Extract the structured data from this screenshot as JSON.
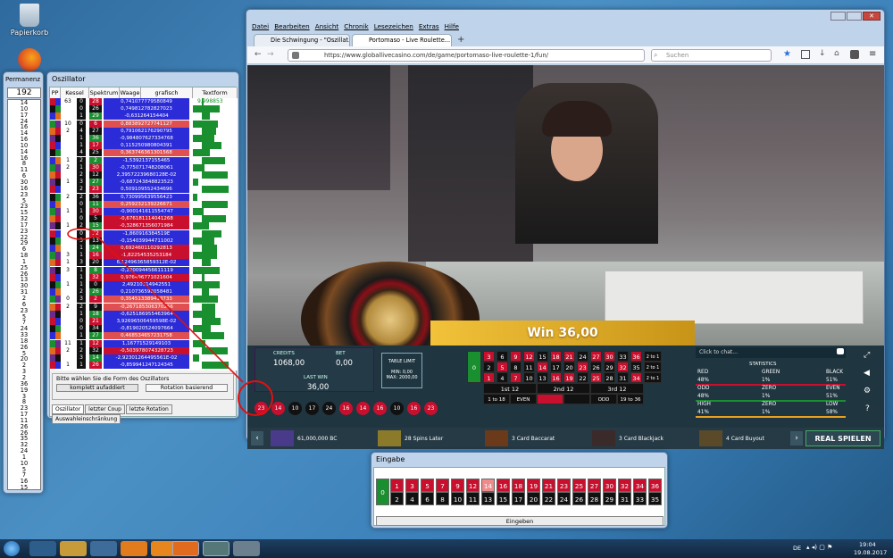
{
  "desktop": {
    "recycle_label": "Papierkorb"
  },
  "permanenz": {
    "title": "Permanenz",
    "current": "192",
    "numbers": [
      "14",
      "10",
      "17",
      "24",
      "16",
      "14",
      "16",
      "10",
      "14",
      "16",
      "8",
      "11",
      "6",
      "30",
      "16",
      "23",
      "5",
      "23",
      "15",
      "32",
      "17",
      "23",
      "22",
      "29",
      "6",
      "18",
      "1",
      "25",
      "26",
      "13",
      "30",
      "31",
      "2",
      "6",
      "23",
      "5",
      "7",
      "24",
      "33",
      "18",
      "26",
      "5",
      "20",
      "2",
      "3",
      "2",
      "36",
      "19",
      "3",
      "8",
      "23",
      "17",
      "11",
      "26",
      "26",
      "35",
      "32",
      "24",
      "1",
      "10",
      "5",
      "7",
      "16",
      "15",
      "13",
      "25",
      "26",
      "33",
      "17",
      "1",
      "28",
      "13",
      "33",
      "19",
      "35",
      "2",
      "7",
      "16",
      "14",
      "36",
      "2",
      "31",
      "18",
      "9",
      "15",
      "36",
      "36",
      "35",
      "19",
      "10",
      "23",
      "34",
      "29",
      "16",
      "2",
      "10",
      "35",
      "25",
      "15",
      "15",
      "14",
      "28",
      "35",
      "2",
      "9",
      "25",
      "15",
      "26",
      "22",
      "21",
      "27",
      "29",
      "20",
      "10",
      "17",
      "24",
      "35",
      "16",
      "25",
      "34",
      "14",
      "32",
      "28",
      "27",
      "26",
      "14",
      "21",
      "25",
      "3",
      "27",
      "14",
      "10"
    ]
  },
  "oszillator": {
    "title": "Oszillator",
    "headers": [
      "PP",
      "Kessel",
      "Spektrum",
      "Waage",
      "grafisch",
      "Textform"
    ],
    "top_text_value": "9,998853",
    "rows": [
      {
        "n": "63",
        "a": "0",
        "b": "28",
        "w": "0,741077779580849",
        "c": "#2b2bd8"
      },
      {
        "n": "",
        "a": "0",
        "b": "26",
        "w": "0,749812782827023",
        "c": "#2b2bd8"
      },
      {
        "n": "",
        "a": "1",
        "b": "29",
        "w": "-0,631264154404",
        "c": "#2b2bd8"
      },
      {
        "n": "10",
        "a": "0",
        "b": "6",
        "w": "0,883892727741127",
        "c": "#e05050"
      },
      {
        "n": "2",
        "a": "4",
        "b": "27",
        "w": "0,791062176290795",
        "c": "#2b2bd8"
      },
      {
        "n": "",
        "a": "1",
        "b": "36",
        "w": "-0,984807627334768",
        "c": "#2b2bd8"
      },
      {
        "n": "",
        "a": "1",
        "b": "17",
        "w": "0,115250980804391",
        "c": "#2b2bd8"
      },
      {
        "n": "",
        "a": "4",
        "b": "25",
        "w": "0,363746361301568",
        "c": "#e05050"
      },
      {
        "n": "1",
        "a": "2",
        "b": "2",
        "w": "-1,5392137155465",
        "c": "#2b2bd8"
      },
      {
        "n": "2",
        "a": "1",
        "b": "30",
        "w": "-0,775071748208061",
        "c": "#2b2bd8"
      },
      {
        "n": "",
        "a": "2",
        "b": "12",
        "w": "2,39572239680128E-02",
        "c": "#2b2bd8"
      },
      {
        "n": "1",
        "a": "3",
        "b": "27",
        "w": "-0,687243848823523",
        "c": "#2b2bd8"
      },
      {
        "n": "",
        "a": "2",
        "b": "23",
        "w": "0,509109552434696",
        "c": "#2b2bd8"
      },
      {
        "n": "2",
        "a": "2",
        "b": "36",
        "w": "0,730995639556423",
        "c": "#2b2bd8"
      },
      {
        "n": "",
        "a": "0",
        "b": "11",
        "w": "0,259232139226671",
        "c": "#e05050"
      },
      {
        "n": "1",
        "a": "1",
        "b": "30",
        "w": "-0,900141611554747",
        "c": "#2b2bd8"
      },
      {
        "n": "",
        "a": "0",
        "b": "5",
        "w": "-0,676181114041268",
        "c": "#c8102e"
      },
      {
        "n": "1",
        "a": "2",
        "b": "15",
        "w": "-0,328671356071984",
        "c": "#c8102e"
      },
      {
        "n": "",
        "a": "0",
        "b": "32",
        "w": "-1,860916384519E",
        "c": "#2b2bd8"
      },
      {
        "n": "",
        "a": "3",
        "b": "13",
        "w": "-0,154039944711002",
        "c": "#2b2bd8"
      },
      {
        "n": "",
        "a": "1",
        "b": "24",
        "w": "0,692460110292813",
        "c": "#c8102e"
      },
      {
        "n": "3",
        "a": "1",
        "b": "16",
        "w": "-1,82254535253184",
        "c": "#c8102e"
      },
      {
        "n": "1",
        "a": "3",
        "b": "20",
        "w": "6,12496365859312E-02",
        "c": "#2b2bd8"
      },
      {
        "n": "3",
        "a": "1",
        "b": "8",
        "w": "-0,230094456611119",
        "c": "#2b2bd8"
      },
      {
        "n": "",
        "a": "1",
        "b": "32",
        "w": "0,976496771021604",
        "c": "#c8102e"
      },
      {
        "n": "1",
        "a": "1",
        "b": "0",
        "w": "2,49210314942551",
        "c": "#2b2bd8"
      },
      {
        "n": "",
        "a": "2",
        "b": "26",
        "w": "0,210736598058481",
        "c": "#2b2bd8"
      },
      {
        "n": "0",
        "a": "3",
        "b": "2",
        "w": "0,354513389413733",
        "c": "#e05050"
      },
      {
        "n": "2",
        "a": "2",
        "b": "9",
        "w": "-0,267185306370266",
        "c": "#e05050"
      },
      {
        "n": "",
        "a": "1",
        "b": "18",
        "w": "-0,625186955463964",
        "c": "#2b2bd8"
      },
      {
        "n": "",
        "a": "0",
        "b": "21",
        "w": "3,92696506459598E-02",
        "c": "#2b2bd8"
      },
      {
        "n": "",
        "a": "0",
        "b": "34",
        "w": "-0,819020524097664",
        "c": "#2b2bd8"
      },
      {
        "n": "",
        "a": "1",
        "b": "27",
        "w": "0,468534657231758",
        "c": "#e05050"
      },
      {
        "n": "11",
        "a": "1",
        "b": "12",
        "w": "1,16771529149103",
        "c": "#2b2bd8"
      },
      {
        "n": "2",
        "a": "2",
        "b": "32",
        "w": "-0,503978074328723",
        "c": "#c8102e"
      },
      {
        "n": "",
        "a": "3",
        "b": "14",
        "w": "-2,92301264495561E-02",
        "c": "#2b2bd8"
      },
      {
        "n": "1",
        "a": "1",
        "b": "26",
        "w": "-0,859941247124345",
        "c": "#2b2bd8"
      }
    ],
    "note": "Bitte wählen Sie die Form des Oszillators",
    "btn_left": "komplett aufaddiert",
    "btn_right": "Rotation basierend",
    "tabs": [
      "Oszillator",
      "letzter Coup",
      "letzte Rotation",
      "Auswahleinschränkung"
    ]
  },
  "browser": {
    "menu": [
      "Datei",
      "Bearbeiten",
      "Ansicht",
      "Chronik",
      "Lesezeichen",
      "Extras",
      "Hilfe"
    ],
    "tab1": "Die Schwingung - \"Oszillat...",
    "tab2": "Portomaso - Live Roulette...",
    "url": "https://www.globallivecasino.com/de/game/portomaso-live-roulette-1/fun/",
    "search_placeholder": "Suchen",
    "game_id": "Game ID: 11503162207"
  },
  "game": {
    "win_text": "Win 36,00",
    "credits_label": "CREDITS",
    "credits_value": "1068,00",
    "bet_label": "BET",
    "bet_value": "0,00",
    "lastwin_label": "LAST WIN",
    "lastwin_value": "36,00",
    "table_limit": "TABLE LIMIT",
    "min": "MIN: 0,00",
    "max": "MAX: 2000,00",
    "history": [
      "23",
      "14",
      "10",
      "17",
      "24",
      "16",
      "14",
      "16",
      "10",
      "16",
      "23"
    ],
    "history_red": [
      true,
      true,
      false,
      false,
      false,
      true,
      true,
      true,
      false,
      true,
      true
    ],
    "board_rows": [
      [
        "3",
        "6",
        "9",
        "12",
        "15",
        "18",
        "21",
        "24",
        "27",
        "30",
        "33",
        "36"
      ],
      [
        "2",
        "5",
        "8",
        "11",
        "14",
        "17",
        "20",
        "23",
        "26",
        "29",
        "32",
        "35"
      ],
      [
        "1",
        "4",
        "7",
        "10",
        "13",
        "16",
        "19",
        "22",
        "25",
        "28",
        "31",
        "34"
      ]
    ],
    "col_label": "2 to 1",
    "dozens": [
      "1st 12",
      "2nd 12",
      "3rd 12"
    ],
    "outside": [
      "1 to 18",
      "EVEN",
      "ODD",
      "19 to 36"
    ],
    "chat_placeholder": "Click to chat...",
    "stats_title": "STATISTICS",
    "stats": [
      {
        "l": "RED",
        "m": "GREEN",
        "r": "BLACK"
      },
      {
        "l": "48%",
        "m": "1%",
        "r": "51%"
      },
      {
        "l": "ODD",
        "m": "ZERO",
        "r": "EVEN"
      },
      {
        "l": "48%",
        "m": "1%",
        "r": "51%"
      },
      {
        "l": "HIGH",
        "m": "ZERO",
        "r": "LOW"
      },
      {
        "l": "41%",
        "m": "1%",
        "r": "58%"
      }
    ],
    "promos": [
      "61,000,000 BC",
      "28 Spins Later",
      "3 Card Baccarat",
      "3 Card Blackjack",
      "4 Card Buyout"
    ],
    "real_play": "REAL SPIELEN",
    "zero": "0"
  },
  "eingabe": {
    "title": "Eingabe",
    "zero": "0",
    "row1": [
      "1",
      "3",
      "5",
      "7",
      "9",
      "12",
      "14",
      "16",
      "18",
      "19",
      "21",
      "23",
      "25",
      "27",
      "30",
      "32",
      "34",
      "36"
    ],
    "row2": [
      "2",
      "4",
      "6",
      "8",
      "10",
      "11",
      "13",
      "15",
      "17",
      "20",
      "22",
      "24",
      "26",
      "28",
      "29",
      "31",
      "33",
      "35"
    ],
    "button": "Eingeben"
  },
  "taskbar": {
    "lang": "DE",
    "time": "19:04",
    "date": "19.08.2017"
  }
}
